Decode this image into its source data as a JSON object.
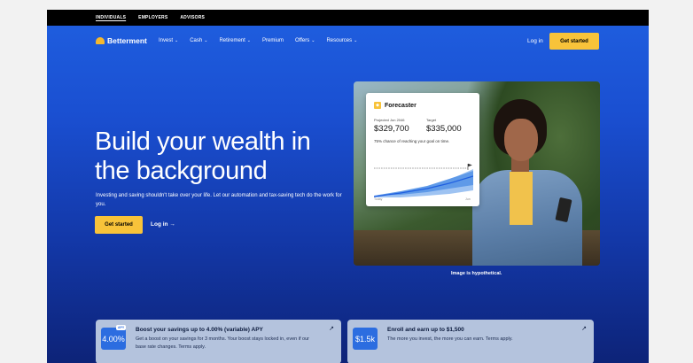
{
  "topbar": {
    "items": [
      "INDIVIDUALS",
      "EMPLOYERS",
      "ADVISORS"
    ]
  },
  "nav": {
    "logo": "Betterment",
    "menu": [
      {
        "label": "Invest",
        "has_menu": true
      },
      {
        "label": "Cash",
        "has_menu": true
      },
      {
        "label": "Retirement",
        "has_menu": true
      },
      {
        "label": "Premium",
        "has_menu": false
      },
      {
        "label": "Offers",
        "has_menu": true
      },
      {
        "label": "Resources",
        "has_menu": true
      }
    ],
    "login": "Log in",
    "cta": "Get started"
  },
  "hero": {
    "title": "Build your wealth in the background",
    "subtitle": "Investing and saving shouldn't take over your life. Let our automation and tax-saving tech do the work for you.",
    "cta": "Get started",
    "login": "Log in →"
  },
  "forecaster": {
    "title": "Forecaster",
    "projected_label": "Projected Jun 2046",
    "projected_value": "$329,700",
    "target_label": "Target",
    "target_value": "$335,000",
    "chance": "75% chance of reaching your goal on time.",
    "axis_start": "Today",
    "axis_end": "Jun"
  },
  "caption": "Image is hypothetical.",
  "promos": [
    {
      "badge": "4.00%",
      "tag": "APY",
      "title": "Boost your savings up to 4.00% (variable) APY",
      "body": "Get a boost on your savings for 3 months. Your boost stays locked in, even if our base rate changes. Terms apply."
    },
    {
      "badge": "$1.5k",
      "title": "Enroll and earn up to $1,500",
      "body": "The more you invest, the more you can earn. Terms apply."
    }
  ],
  "colors": {
    "accent": "#f8c33a",
    "hero_top": "#1f5fe0",
    "hero_bottom": "#0d2378",
    "promo_bg": "#b4c3dd"
  }
}
